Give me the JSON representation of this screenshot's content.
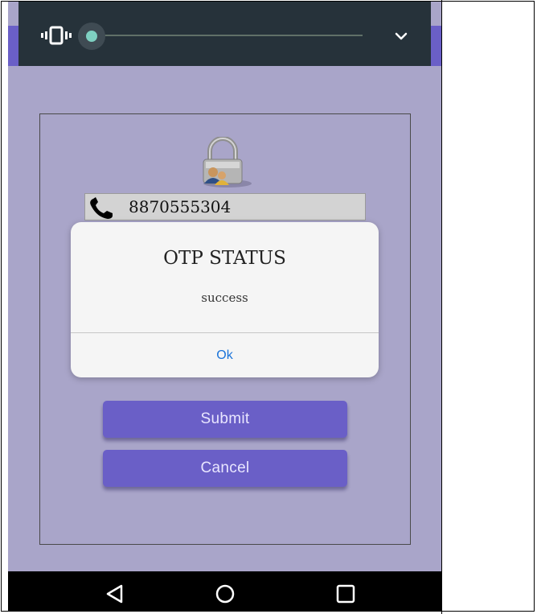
{
  "volume_panel": {
    "icons": {
      "mode": "vibrate-icon",
      "expand": "chevron-down-icon"
    },
    "level": 0.0
  },
  "card": {
    "icon": "lock-users-icon",
    "phone": {
      "icon": "phone-icon",
      "value": "8870555304"
    }
  },
  "dialog": {
    "title": "OTP STATUS",
    "message": "success",
    "ok_label": "Ok"
  },
  "buttons": {
    "submit": "Submit",
    "cancel": "Cancel"
  },
  "nav_bar": {
    "icons": [
      "back-icon",
      "home-icon",
      "recents-icon"
    ]
  },
  "colors": {
    "background": "#a9a5c9",
    "accent": "#6a5fc7",
    "dialog_action": "#1a73d9",
    "volume_panel": "#26323a"
  }
}
